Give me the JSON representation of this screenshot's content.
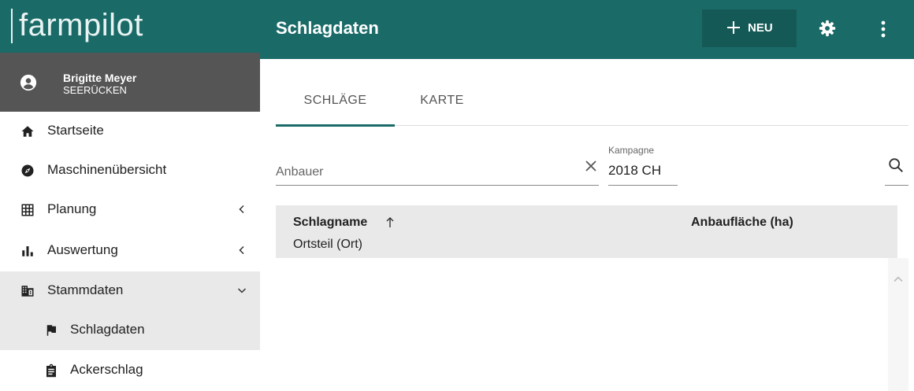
{
  "brand": {
    "name": "farmpilot"
  },
  "user": {
    "name": "Brigitte Meyer",
    "organization": "SEERÜCKEN"
  },
  "sidebar": {
    "items": [
      {
        "label": "Startseite",
        "icon": "home-icon"
      },
      {
        "label": "Maschinenübersicht",
        "icon": "compass-icon"
      },
      {
        "label": "Planung",
        "icon": "grid-icon",
        "chevron": "left"
      },
      {
        "label": "Auswertung",
        "icon": "bar-chart-icon",
        "chevron": "left"
      },
      {
        "label": "Stammdaten",
        "icon": "building-icon",
        "chevron": "down",
        "expanded": true
      },
      {
        "label": "Schlagdaten",
        "icon": "flag-icon",
        "sub": true,
        "active": true
      },
      {
        "label": "Ackerschlag",
        "icon": "clipboard-icon",
        "sub": true
      }
    ]
  },
  "header": {
    "title": "Schlagdaten",
    "new_label": "NEU"
  },
  "tabs": [
    {
      "label": "SCHLÄGE",
      "active": true
    },
    {
      "label": "KARTE",
      "active": false
    }
  ],
  "filters": {
    "anbauer_placeholder": "Anbauer",
    "anbauer_value": "",
    "kampagne_label": "Kampagne",
    "kampagne_value": "2018 CH"
  },
  "table": {
    "columns": [
      {
        "label": "Schlagname",
        "sub_label": "Ortsteil (Ort)",
        "sort": "ascending"
      },
      {
        "label": "Anbaufläche (ha)"
      }
    ],
    "rows": []
  },
  "colors": {
    "primary": "#1a6b68",
    "primary_dark": "#155956",
    "user_bg": "#555555",
    "active_bg": "#e9e9e9"
  }
}
